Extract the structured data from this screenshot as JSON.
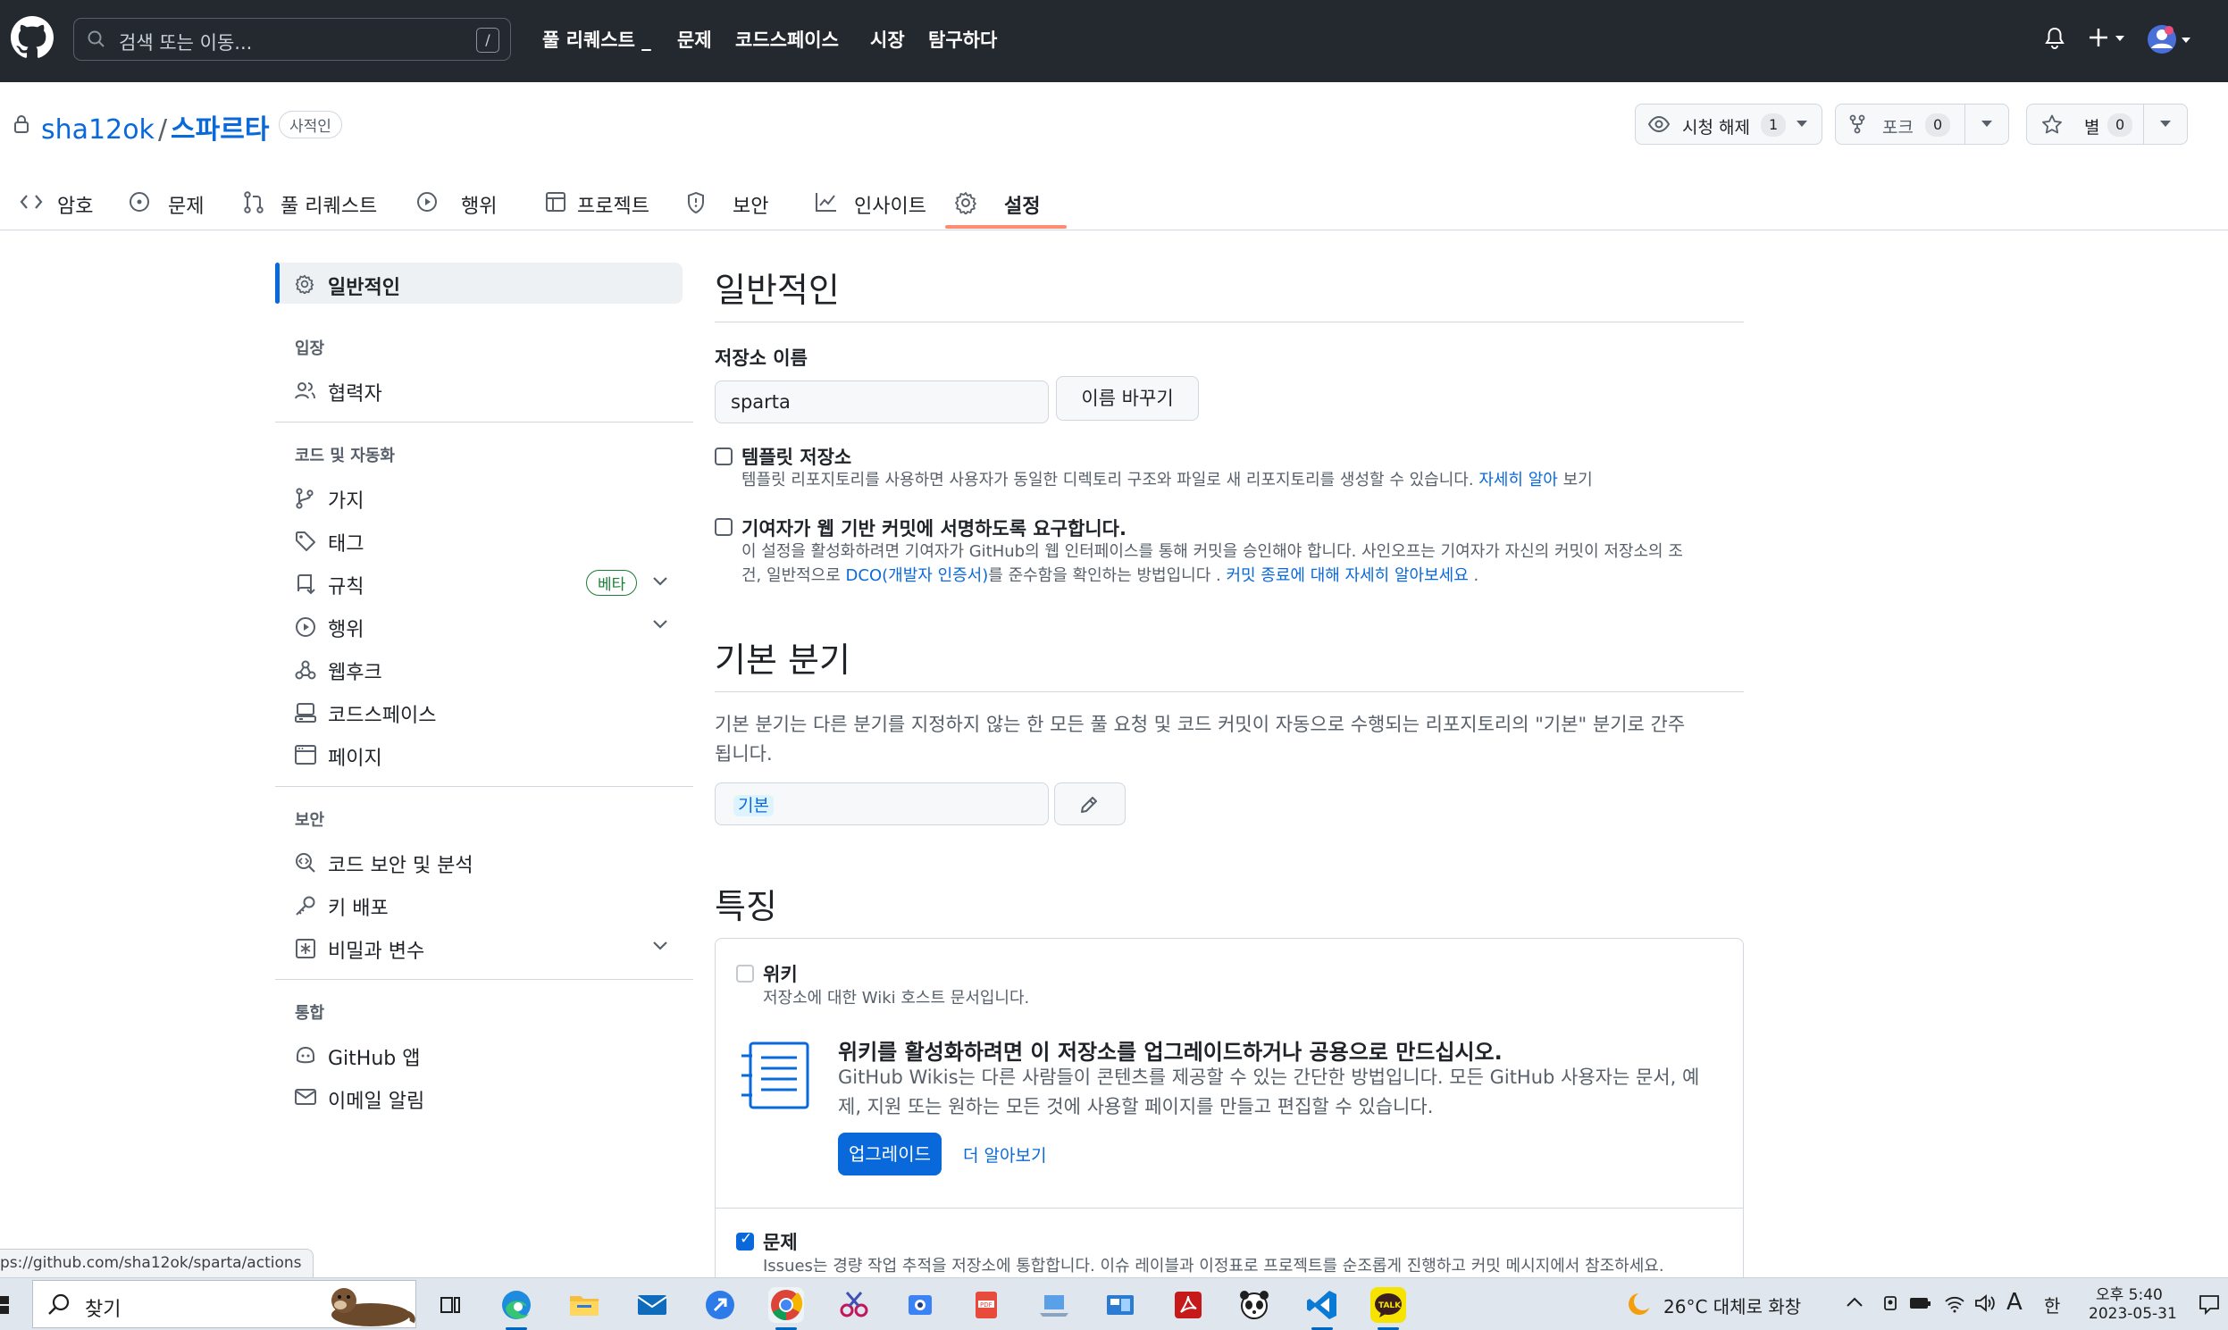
{
  "header": {
    "search_placeholder": "검색 또는 이동...",
    "slash_key": "/",
    "nav": [
      "풀 리퀘스트 _",
      "문제",
      "코드스페이스",
      "시장",
      "탐구하다"
    ]
  },
  "repo": {
    "owner": "sha12ok",
    "separator": "/",
    "name": "스파르타",
    "visibility": "사적인",
    "watch_label": "시청 해제",
    "watch_count": "1",
    "fork_label": "포크",
    "fork_count": "0",
    "star_label": "별",
    "star_count": "0"
  },
  "tabs": [
    {
      "label": "암호",
      "icon": "code-icon"
    },
    {
      "label": "문제",
      "icon": "issue-icon"
    },
    {
      "label": "풀 리퀘스트",
      "icon": "pull-request-icon"
    },
    {
      "label": "행위",
      "icon": "play-icon"
    },
    {
      "label": "프로젝트",
      "icon": "table-icon"
    },
    {
      "label": "보안",
      "icon": "shield-icon"
    },
    {
      "label": "인사이트",
      "icon": "graph-icon"
    },
    {
      "label": "설정",
      "icon": "gear-icon",
      "active": true
    }
  ],
  "sidebar": {
    "general": "일반적인",
    "access_heading": "입장",
    "collaborators": "협력자",
    "code_heading": "코드 및 자동화",
    "branches": "가지",
    "tags": "태그",
    "rules": "규칙",
    "beta": "베타",
    "actions": "행위",
    "webhooks": "웹후크",
    "codespaces": "코드스페이스",
    "pages": "페이지",
    "security_heading": "보안",
    "code_security": "코드 보안 및 분석",
    "deploy_keys": "키 배포",
    "secrets": "비밀과 변수",
    "integrations_heading": "통합",
    "github_apps": "GitHub 앱",
    "email_notifications": "이메일 알림"
  },
  "main": {
    "general_title": "일반적인",
    "repo_name_label": "저장소 이름",
    "repo_name_value": "sparta",
    "rename_button": "이름 바꾸기",
    "template_label": "템플릿 저장소",
    "template_desc": "템플릿 리포지토리를 사용하면 사용자가 동일한 디렉토리 구조와 파일로 새 리포지토리를 생성할 수 있습니다.",
    "template_link": "자세히 알아",
    "template_link_tail": "보기",
    "signoff_label": "기여자가 웹 기반 커밋에 서명하도록 요구합니다.",
    "signoff_desc_1": "이 설정을 활성화하려면 기여자가 GitHub의 웹 인터페이스를 통해 커밋을 승인해야 합니다. 사인오프는 기여자가 자신의 커밋이 저장소의 조",
    "signoff_desc_2": "건, 일반적으로",
    "signoff_link_dco": "DCO(개발자 인증서)",
    "signoff_desc_3": "를 준수함을 확인하는 방법입니다 .",
    "signoff_link_more": "커밋 종료에 대해 자세히 알아보세요",
    "signoff_desc_4": ".",
    "branch_title": "기본 분기",
    "branch_desc_1": "기본 분기는 다른 분기를 지정하지 않는 한 모든 풀 요청 및 코드 커밋이 자동으로 수행되는 리포지토리의 \"기본\" 분기로 간주",
    "branch_desc_2": "됩니다.",
    "branch_value": "기본",
    "features_title": "특징",
    "wiki_label": "위키",
    "wiki_desc": "저장소에 대한 Wiki 호스트 문서입니다.",
    "wiki_upgrade_title": "위키를 활성화하려면 이 저장소를 업그레이드하거나 공용으로 만드십시오.",
    "wiki_upgrade_desc_1": "GitHub Wikis는 다른 사람들이 콘텐츠를 제공할 수 있는 간단한 방법입니다. 모든 GitHub 사용자는 문서, 예",
    "wiki_upgrade_desc_2": "제, 지원 또는 원하는 모든 것에 사용할 페이지를 만들고 편집할 수 있습니다.",
    "upgrade_button": "업그레이드",
    "learn_more": "더 알아보기",
    "issues_label": "문제",
    "issues_desc": "Issues는 경량 작업 추적을 저장소에 통합합니다. 이슈 레이블과 이정표로 프로젝트를 순조롭게 진행하고 커밋 메시지에서 참조하세요."
  },
  "status_url": "ps://github.com/sha12ok/sparta/actions",
  "taskbar": {
    "search": "찾기",
    "weather": "26°C  대체로 화창",
    "ime_a": "A",
    "ime_han": "한",
    "time": "오후 5:40",
    "date": "2023-05-31"
  },
  "colors": {
    "header_bg": "#24292f",
    "accent": "#0969da",
    "tab_underline": "#fd8c73",
    "success": "#1a7f37"
  }
}
